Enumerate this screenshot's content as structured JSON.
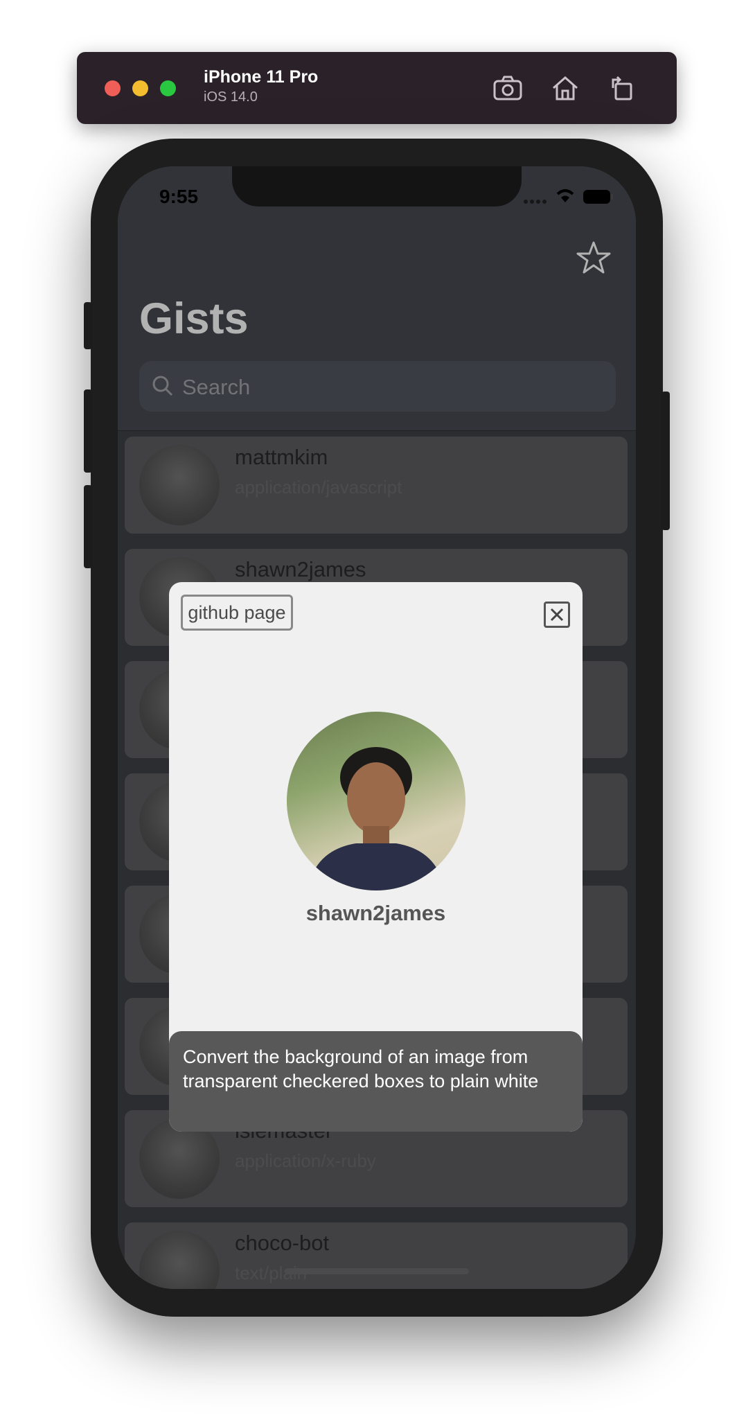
{
  "simulator": {
    "device_name": "iPhone 11 Pro",
    "os_version": "iOS 14.0",
    "icons": [
      "screenshot-icon",
      "home-icon",
      "rotate-icon"
    ]
  },
  "status_bar": {
    "time": "9:55"
  },
  "header": {
    "title": "Gists",
    "favorites_icon": "star-icon"
  },
  "search": {
    "placeholder": "Search"
  },
  "gists": [
    {
      "owner": "mattmkim",
      "file_type": "application/javascript"
    },
    {
      "owner": "shawn2james",
      "file_type": ""
    },
    {
      "owner": "",
      "file_type": ""
    },
    {
      "owner": "",
      "file_type": ""
    },
    {
      "owner": "",
      "file_type": ""
    },
    {
      "owner": "",
      "file_type": ""
    },
    {
      "owner": "isiemaster",
      "file_type": "application/x-ruby"
    },
    {
      "owner": "choco-bot",
      "file_type": "text/plain"
    }
  ],
  "modal": {
    "github_button": "github page",
    "close_icon": "close-icon",
    "username": "shawn2james",
    "description": "Convert the background of an image from transparent checkered boxes to plain white"
  },
  "colors": {
    "header_bg": "#474a51",
    "modal_bg": "#f0f0f0",
    "tooltip_bg": "#585858"
  }
}
